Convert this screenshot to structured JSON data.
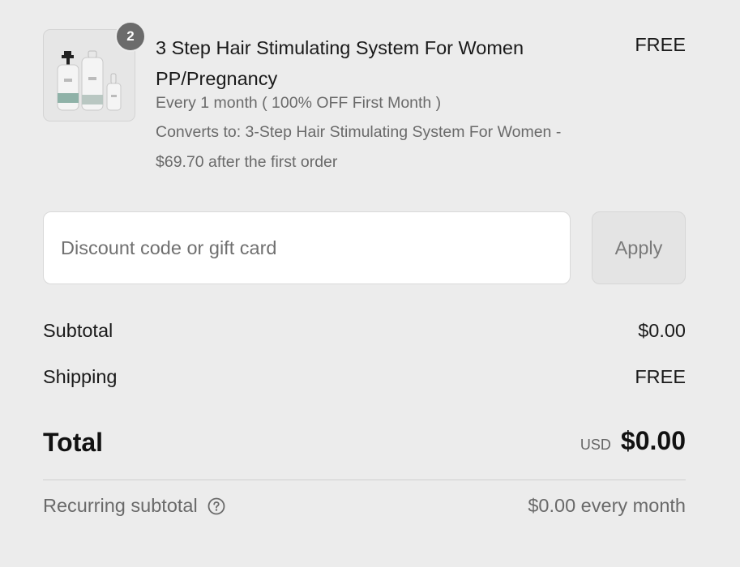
{
  "product": {
    "quantity": "2",
    "title": "3 Step Hair Stimulating System For Women PP/Pregnancy",
    "price": "FREE",
    "frequency": "Every 1 month ( 100% OFF First Month )",
    "converts_line1": "Converts to: 3-Step Hair Stimulating System For Women -",
    "converts_line2": "$69.70 after the first order",
    "image_icon": "product-bottles-icon"
  },
  "discount": {
    "placeholder": "Discount code or gift card",
    "value": "",
    "apply_label": "Apply"
  },
  "summary": {
    "subtotal_label": "Subtotal",
    "subtotal_value": "$0.00",
    "shipping_label": "Shipping",
    "shipping_value": "FREE",
    "total_label": "Total",
    "currency": "USD",
    "total_value": "$0.00",
    "recurring_label": "Recurring subtotal",
    "recurring_value": "$0.00 every month",
    "help_icon": "question-circle-icon"
  },
  "colors": {
    "background": "#ececec",
    "badge": "#6b6b6b",
    "text_primary": "#1a1a1a",
    "text_secondary": "#6a6a6a"
  }
}
